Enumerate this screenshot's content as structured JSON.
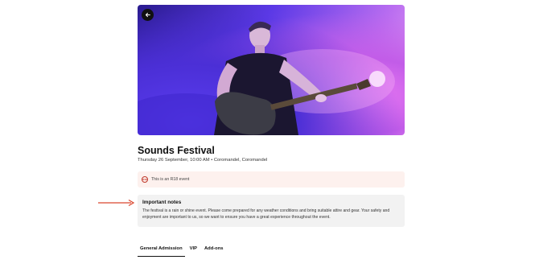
{
  "event": {
    "title": "Sounds Festival",
    "meta": "Thursday 26 September, 10:00 AM • Coromandel, Coromandel"
  },
  "age_notice": {
    "badge": "R18",
    "text": "This is an R18 event"
  },
  "notes": {
    "title": "Important notes",
    "body": "The festival is a rain or shine event. Please come prepared for any weather conditions and bring suitable attire and gear. Your safety and enjoyment are important to us, so we want to ensure you have a great experience throughout the event."
  },
  "tabs": [
    {
      "label": "General Admission",
      "active": true
    },
    {
      "label": "VIP",
      "active": false
    },
    {
      "label": "Add-ons",
      "active": false
    }
  ],
  "icons": {
    "back": "arrow-left-icon",
    "annotation": "arrow-right-icon"
  },
  "colors": {
    "hero_gradient": [
      "#2a1b8f",
      "#5b39e6",
      "#b96df0",
      "#f1a9f5"
    ],
    "r18_background": "#fdf1ee",
    "r18_accent": "#c0392b",
    "notes_background": "#f2f2f2",
    "annotation_arrow": "#d9462e"
  }
}
